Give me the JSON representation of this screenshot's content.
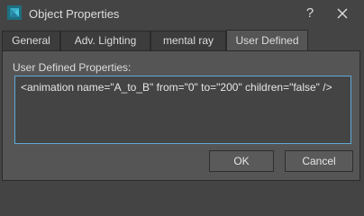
{
  "window": {
    "title": "Object Properties",
    "help_glyph": "?",
    "icon": "3ds-max-app-icon"
  },
  "tabs": [
    {
      "label": "General",
      "active": false
    },
    {
      "label": "Adv. Lighting",
      "active": false
    },
    {
      "label": "mental ray",
      "active": false
    },
    {
      "label": "User Defined",
      "active": true
    }
  ],
  "user_defined": {
    "label": "User Defined Properties:",
    "value": "<animation name=\"A_to_B\" from=\"0\" to=\"200\" children=\"false\" />"
  },
  "buttons": {
    "ok": "OK",
    "cancel": "Cancel"
  },
  "colors": {
    "background": "#444444",
    "panel": "#555555",
    "focus_border": "#5fa9d8",
    "icon_accent": "#3ab0c8"
  }
}
